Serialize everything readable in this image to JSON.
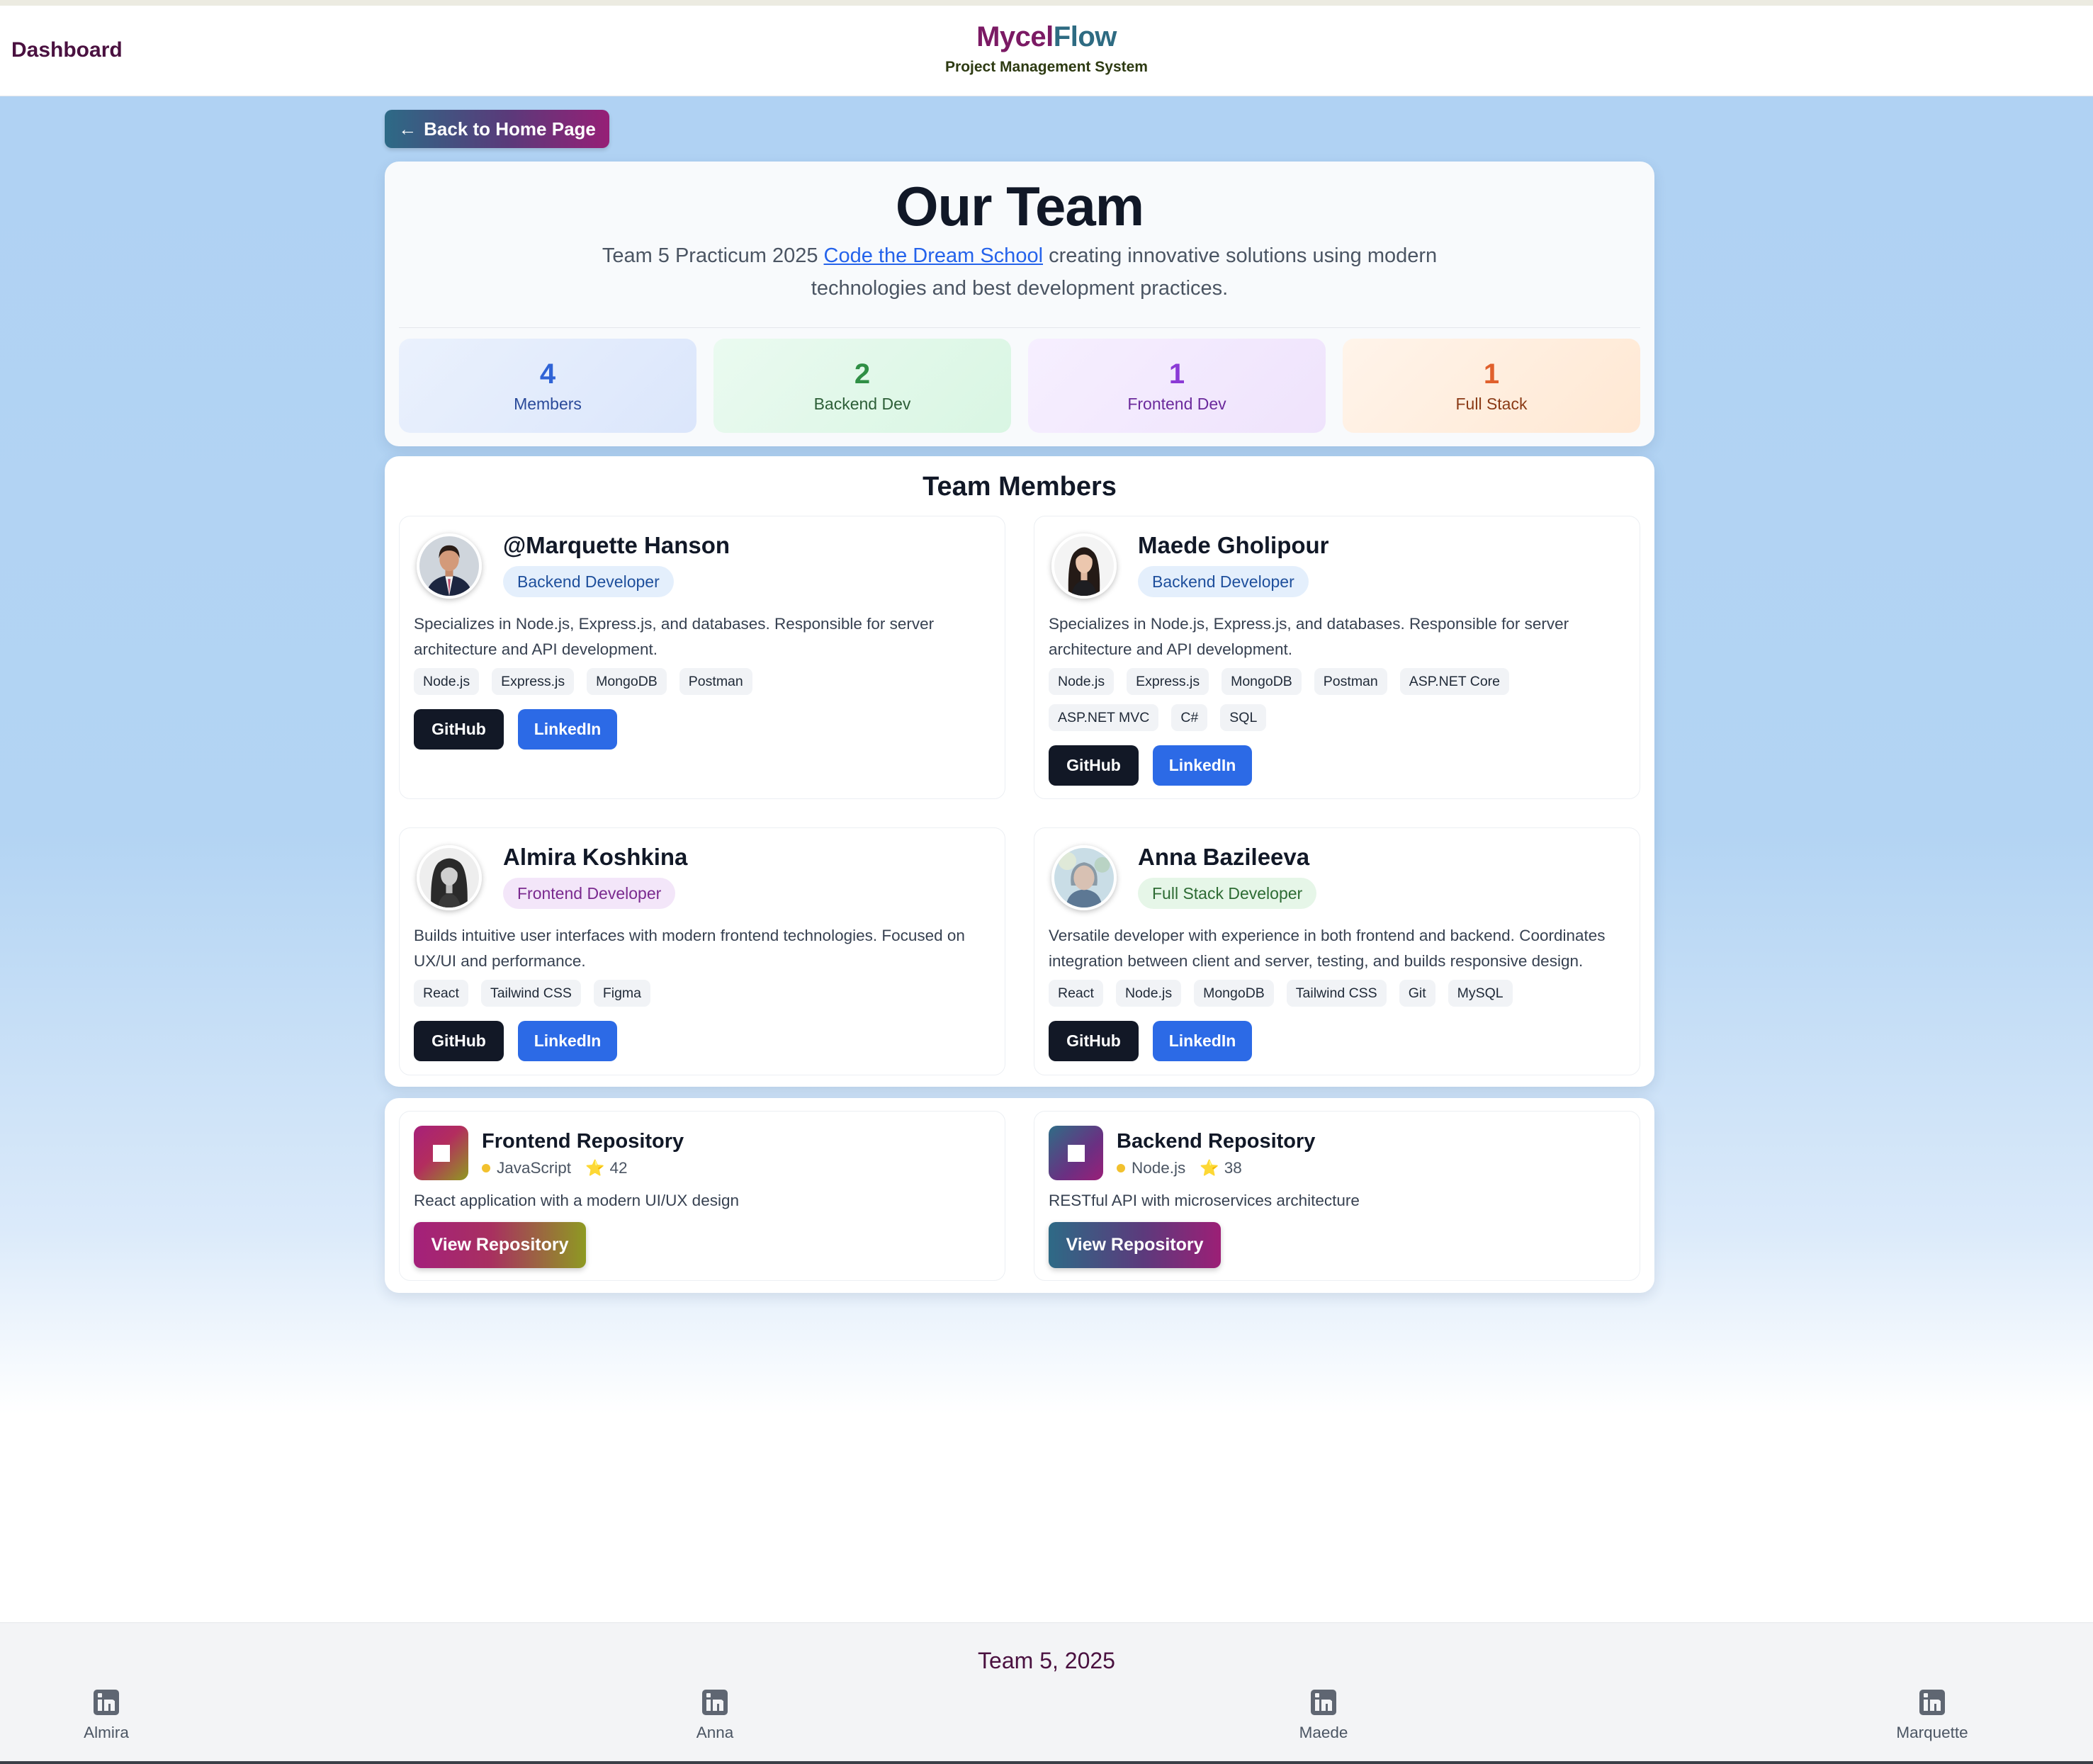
{
  "navbar": {
    "dashboard_label": "Dashboard",
    "brand_part1": "Mycel",
    "brand_part2": "Flow",
    "brand_subtitle": "Project Management System"
  },
  "back_button": {
    "label": "Back to Home Page",
    "icon": "arrow-left-icon"
  },
  "hero": {
    "title": "Our Team",
    "desc_before": "Team 5 Practicum 2025 ",
    "desc_link": "Code the Dream School",
    "desc_after": " creating innovative solutions using modern technologies and best development practices."
  },
  "stats": [
    {
      "value": "4",
      "label": "Members",
      "color": "#2f63d6"
    },
    {
      "value": "2",
      "label": "Backend Dev",
      "color": "#2f8f45"
    },
    {
      "value": "1",
      "label": "Frontend Dev",
      "color": "#8b3ad6"
    },
    {
      "value": "1",
      "label": "Full Stack",
      "color": "#e0602c"
    }
  ],
  "members_section": {
    "title": "Team Members",
    "members": [
      {
        "name": "@Marquette Hanson",
        "role": "Backend Developer",
        "description": "Specializes in Node.js, Express.js, and databases. Responsible for server architecture and API development.",
        "skills": [
          "Node.js",
          "Express.js",
          "MongoDB",
          "Postman"
        ],
        "github_label": "GitHub",
        "linkedin_label": "LinkedIn"
      },
      {
        "name": "Maede Gholipour",
        "role": "Backend Developer",
        "description": "Specializes in Node.js, Express.js, and databases. Responsible for server architecture and API development.",
        "skills": [
          "Node.js",
          "Express.js",
          "MongoDB",
          "Postman",
          "ASP.NET Core",
          "ASP.NET MVC",
          "C#",
          "SQL"
        ],
        "github_label": "GitHub",
        "linkedin_label": "LinkedIn"
      },
      {
        "name": "Almira Koshkina",
        "role": "Frontend Developer",
        "description": "Builds intuitive user interfaces with modern frontend technologies. Focused on UX/UI and performance.",
        "skills": [
          "React",
          "Tailwind CSS",
          "Figma"
        ],
        "github_label": "GitHub",
        "linkedin_label": "LinkedIn"
      },
      {
        "name": "Anna Bazileeva",
        "role": "Full Stack Developer",
        "description": "Versatile developer with experience in both frontend and backend. Coordinates integration between client and server, testing, and builds responsive design.",
        "skills": [
          "React",
          "Node.js",
          "MongoDB",
          "Tailwind CSS",
          "Git",
          "MySQL"
        ],
        "github_label": "GitHub",
        "linkedin_label": "LinkedIn"
      }
    ]
  },
  "repositories": [
    {
      "title": "Frontend Repository",
      "language": "JavaScript",
      "stars": "42",
      "description": "React application with a modern UI/UX design",
      "button_label": "View Repository"
    },
    {
      "title": "Backend Repository",
      "language": "Node.js",
      "stars": "38",
      "description": "RESTful API with microservices architecture",
      "button_label": "View Repository"
    }
  ],
  "footer": {
    "title": "Team 5, 2025",
    "links": [
      {
        "name": "Almira",
        "icon": "linkedin-icon"
      },
      {
        "name": "Anna",
        "icon": "linkedin-icon"
      },
      {
        "name": "Maede",
        "icon": "linkedin-icon"
      },
      {
        "name": "Marquette",
        "icon": "linkedin-icon"
      }
    ]
  }
}
